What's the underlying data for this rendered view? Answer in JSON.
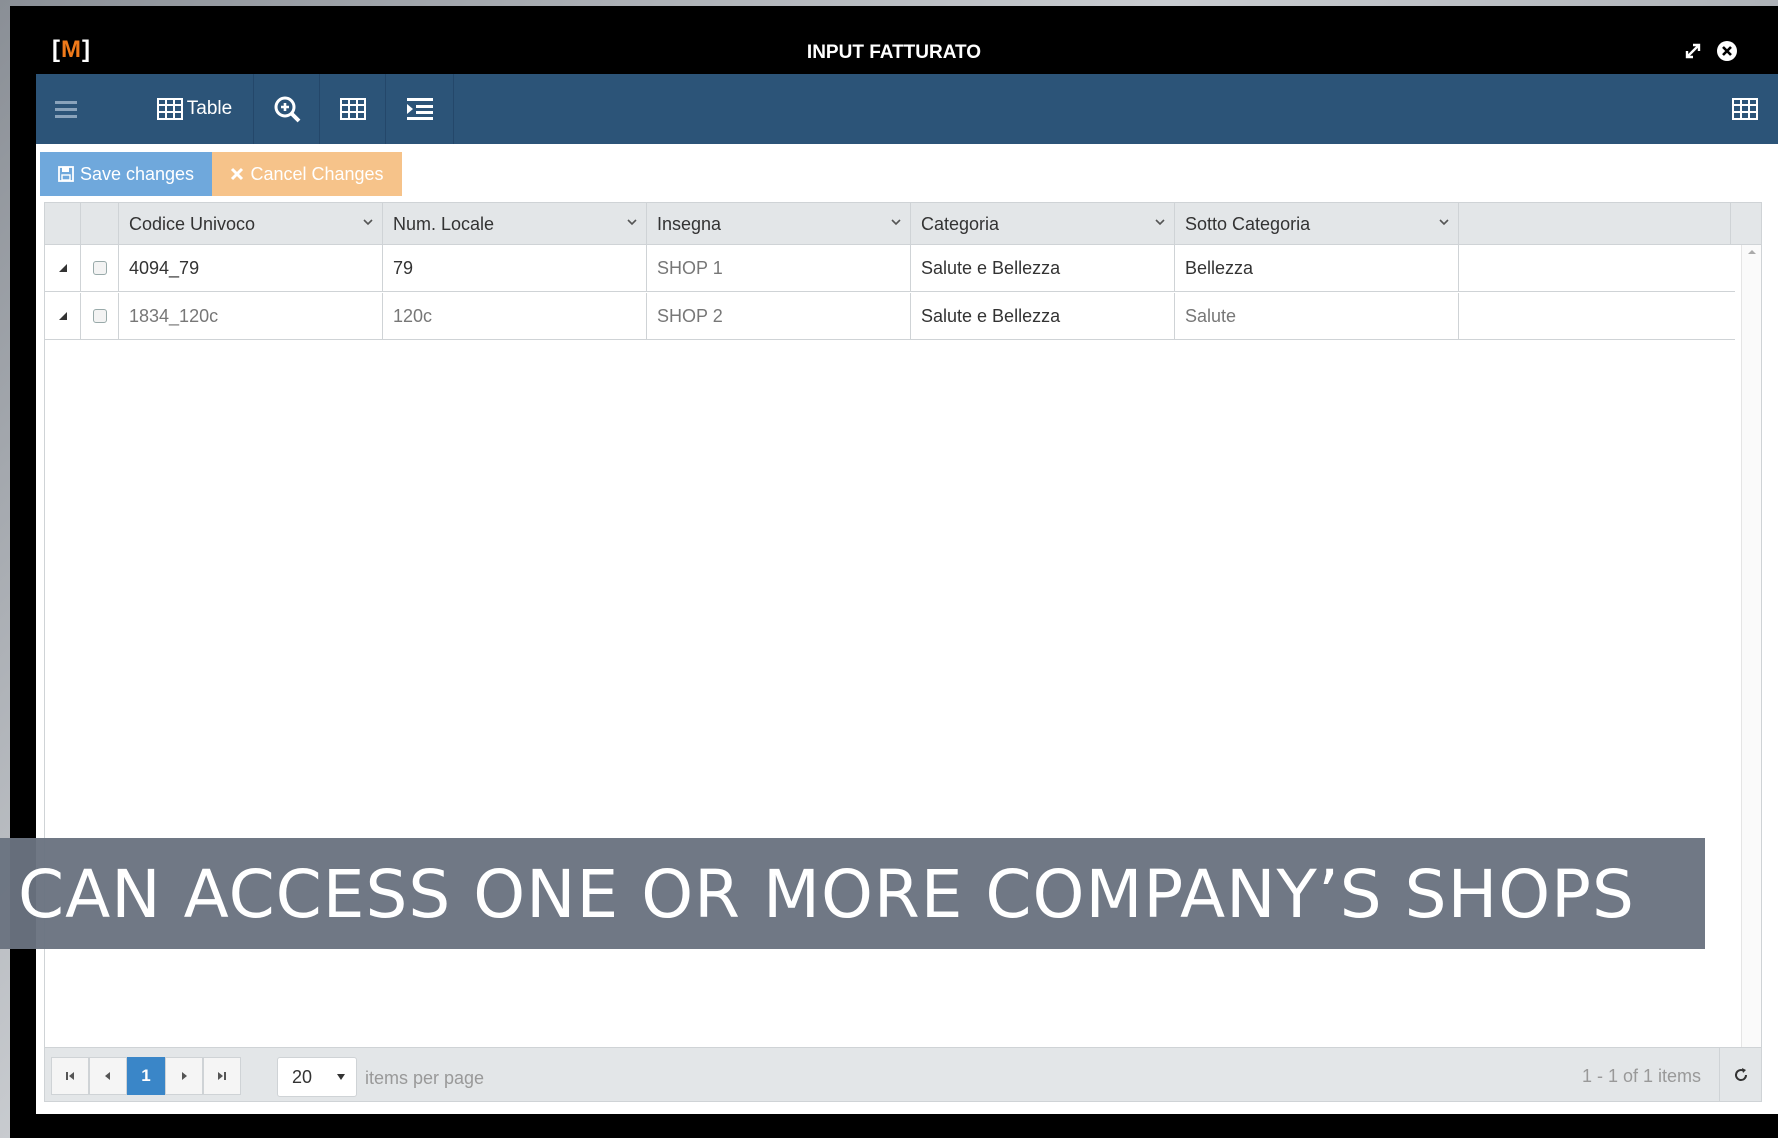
{
  "window": {
    "logo_left": "[",
    "logo_letter": "M",
    "logo_right": "]",
    "title": "INPUT FATTURATO"
  },
  "toolbar": {
    "table_label": "Table"
  },
  "actions": {
    "save_label": "Save changes",
    "cancel_label": "Cancel Changes"
  },
  "grid": {
    "columns": [
      "Codice Univoco",
      "Num. Locale",
      "Insegna",
      "Categoria",
      "Sotto Categoria"
    ],
    "rows": [
      {
        "codice": "4094_79",
        "num": "79",
        "insegna": "SHOP 1",
        "categoria": "Salute e Bellezza",
        "sotto": "Bellezza"
      },
      {
        "codice": "1834_120c",
        "num": "120c",
        "insegna": "SHOP 2",
        "categoria": "Salute e Bellezza",
        "sotto": "Salute"
      }
    ]
  },
  "pager": {
    "current_page": "1",
    "page_size": "20",
    "items_per_page_label": "items per page",
    "info": "1 - 1 of 1 items"
  },
  "overlay": {
    "caption": "CAN ACCESS ONE OR MORE COMPANY’S SHOPS"
  },
  "colors": {
    "toolbar_bg": "#2c5478",
    "logo_accent": "#f07a1a",
    "save_bg": "#6fa8dc",
    "cancel_bg": "#f6c38a",
    "active_page": "#3a86c8"
  }
}
